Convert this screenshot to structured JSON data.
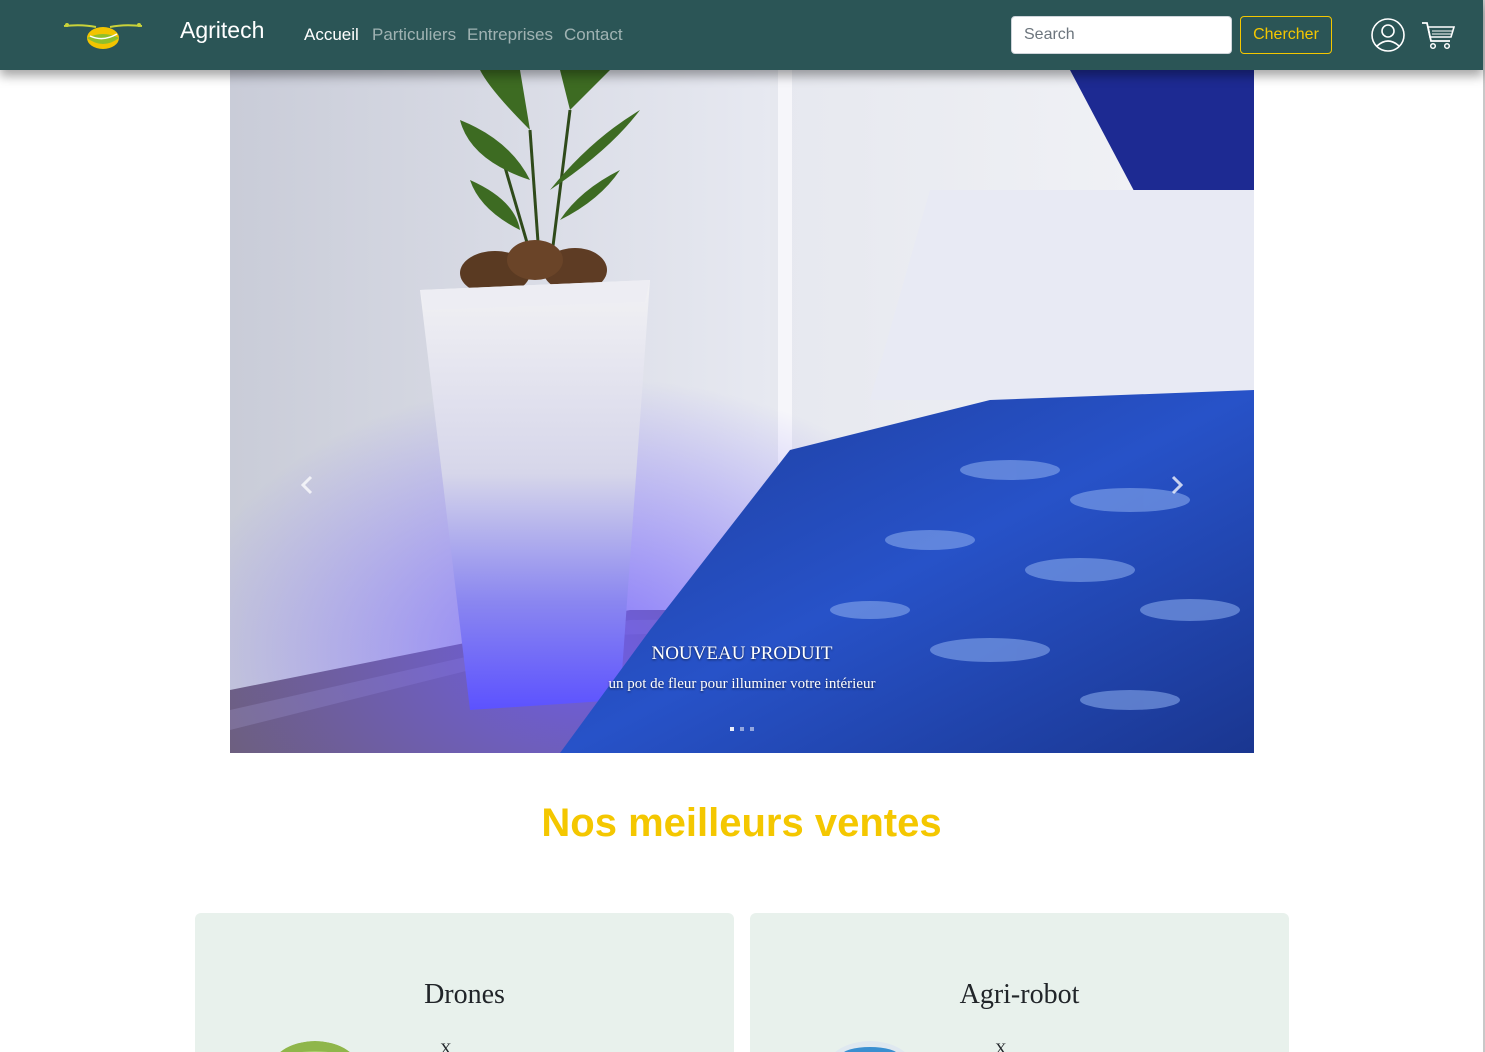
{
  "navbar": {
    "brand": "Agritech",
    "links": [
      {
        "label": "Accueil",
        "active": true
      },
      {
        "label": "Particuliers",
        "active": false
      },
      {
        "label": "Entreprises",
        "active": false
      },
      {
        "label": "Contact",
        "active": false
      }
    ],
    "search": {
      "placeholder": "Search",
      "value": ""
    },
    "search_button": "Chercher",
    "icons": [
      "logo-icon",
      "user-icon",
      "cart-icon"
    ]
  },
  "carousel": {
    "caption_title": "NOUVEAU PRODUIT",
    "caption_text": "un pot de fleur pour illuminer votre intérieur",
    "controls": [
      "prev-arrow-icon",
      "next-arrow-icon"
    ]
  },
  "section": {
    "title": "Nos meilleurs ventes"
  },
  "products": [
    {
      "title": "Drones",
      "text": "X"
    },
    {
      "title": "Agri-robot",
      "text": "X"
    }
  ],
  "colors": {
    "navbar": "#2b5556",
    "accent": "#f4c700",
    "card_bg": "#e8f1ec"
  }
}
